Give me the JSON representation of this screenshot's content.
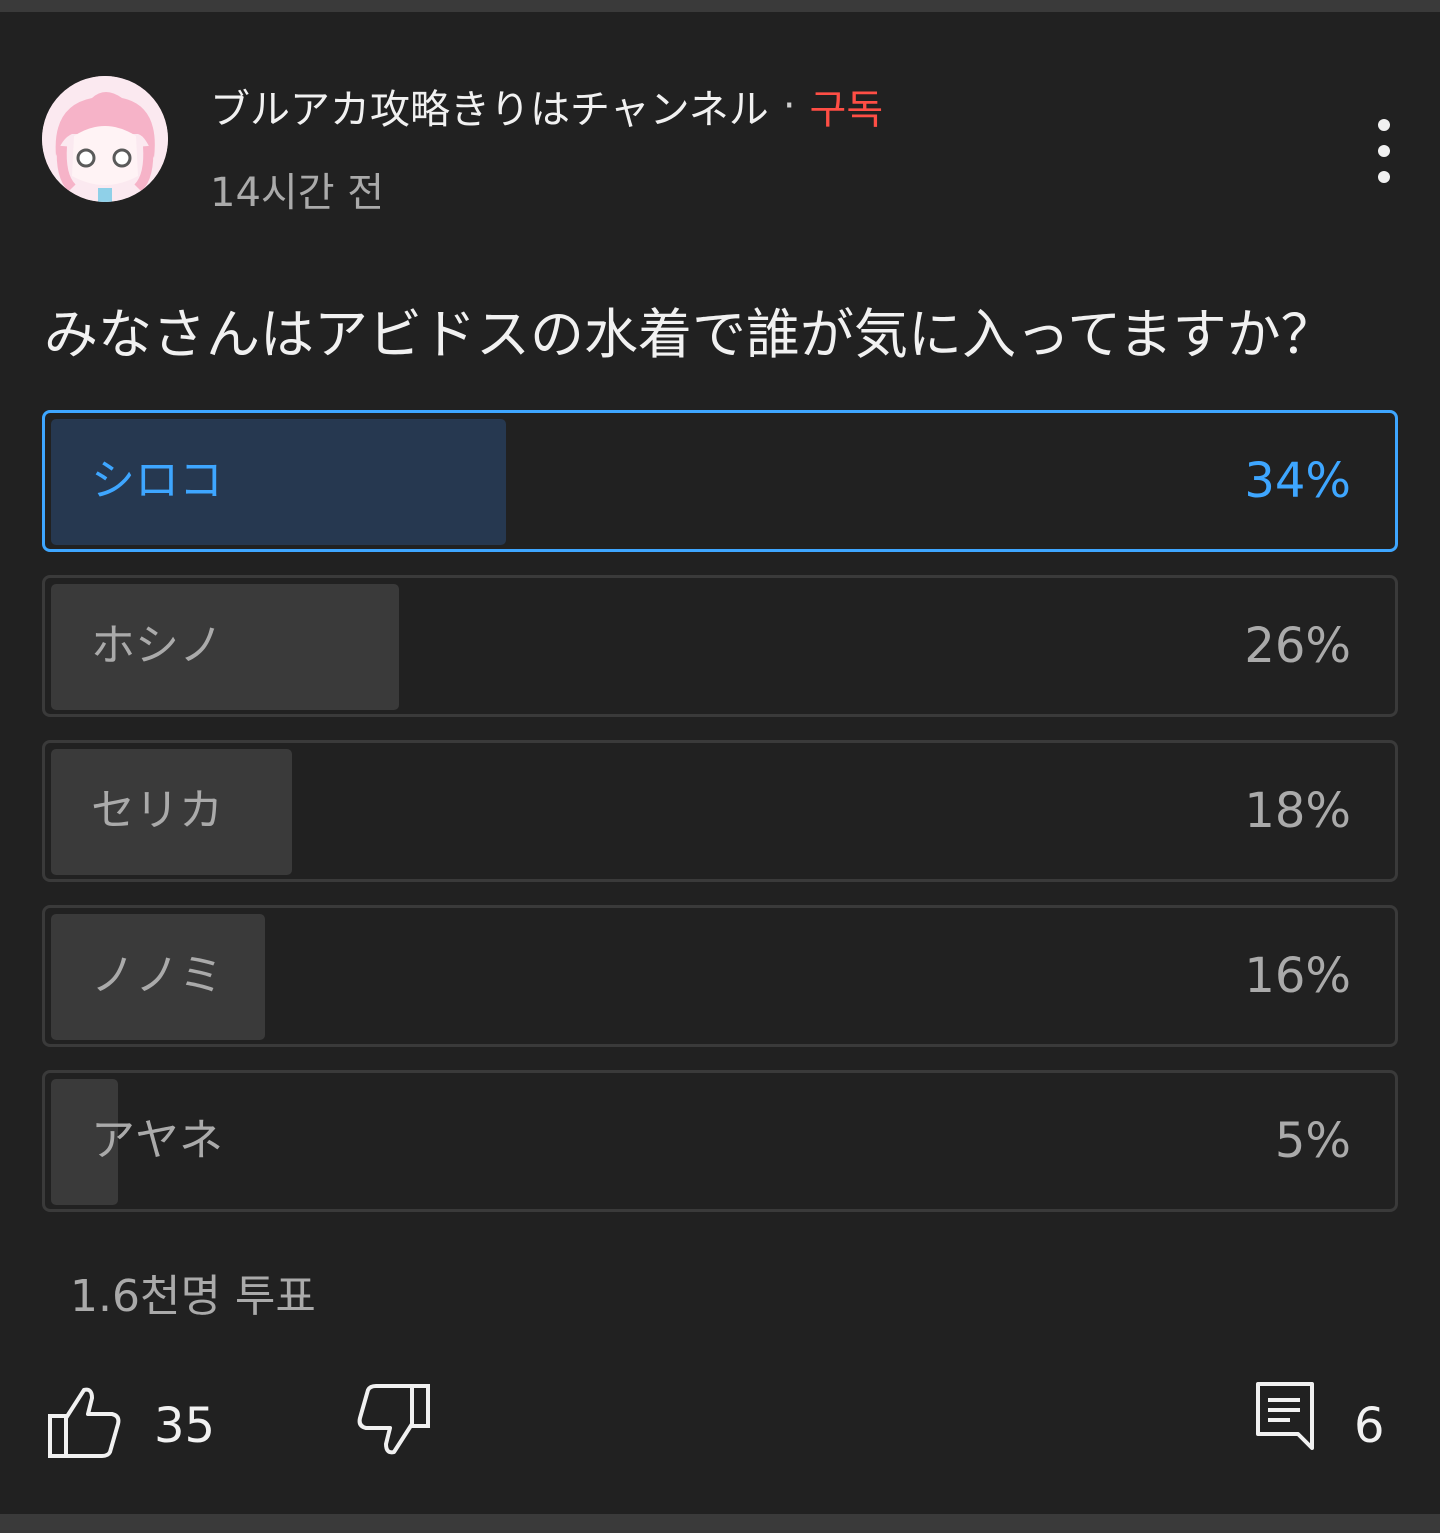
{
  "post": {
    "channel_name": "ブルアカ攻略きりはチャンネル",
    "separator": "·",
    "subscribe_label": "구독",
    "time_ago": "14시간 전",
    "question": "みなさんはアビドスの水着で誰が気に入ってますか？"
  },
  "poll": {
    "options": [
      {
        "label": "シロコ",
        "percent_text": "34%",
        "percent": 34,
        "selected": true
      },
      {
        "label": "ホシノ",
        "percent_text": "26%",
        "percent": 26,
        "selected": false
      },
      {
        "label": "セリカ",
        "percent_text": "18%",
        "percent": 18,
        "selected": false
      },
      {
        "label": "ノノミ",
        "percent_text": "16%",
        "percent": 16,
        "selected": false
      },
      {
        "label": "アヤネ",
        "percent_text": "5%",
        "percent": 5,
        "selected": false
      }
    ],
    "votes_text": "1.6천명 투표"
  },
  "actions": {
    "like_count": "35",
    "comment_count": "6"
  },
  "icons": {
    "menu": "more-vert-icon",
    "like": "thumbs-up-icon",
    "dislike": "thumbs-down-icon",
    "comment": "comment-icon"
  },
  "colors": {
    "accent": "#3ea6ff",
    "subscribe": "#ff4e45",
    "background": "#212121"
  }
}
